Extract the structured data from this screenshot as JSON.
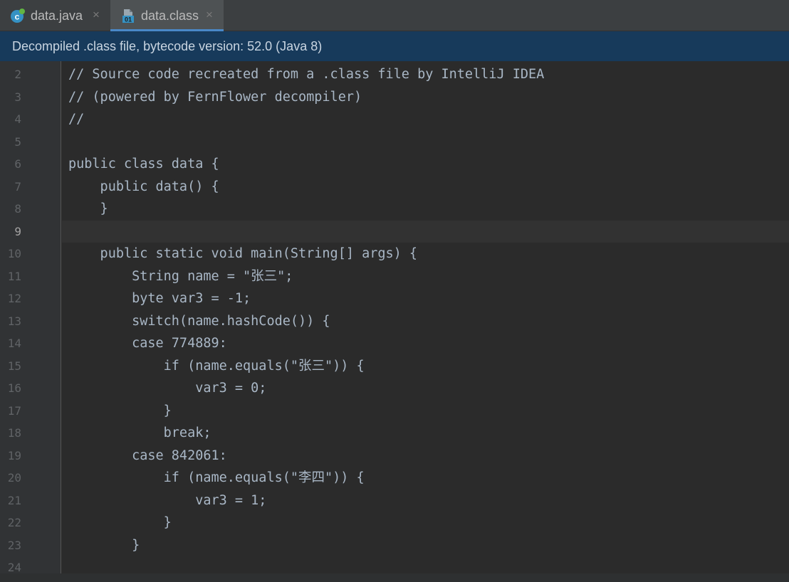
{
  "tabs": [
    {
      "label": "data.java",
      "icon": "java-class-icon",
      "active": false
    },
    {
      "label": "data.class",
      "icon": "class-file-icon",
      "active": true
    }
  ],
  "close_glyph": "×",
  "banner": {
    "text": "Decompiled .class file, bytecode version: 52.0 (Java 8)"
  },
  "editor": {
    "current_line": 9,
    "lines": [
      {
        "num": "2",
        "text": "// Source code recreated from a .class file by IntelliJ IDEA"
      },
      {
        "num": "3",
        "text": "// (powered by FernFlower decompiler)"
      },
      {
        "num": "4",
        "text": "//"
      },
      {
        "num": "5",
        "text": ""
      },
      {
        "num": "6",
        "text": "public class data {"
      },
      {
        "num": "7",
        "text": "    public data() {"
      },
      {
        "num": "8",
        "text": "    }"
      },
      {
        "num": "9",
        "text": ""
      },
      {
        "num": "10",
        "text": "    public static void main(String[] args) {"
      },
      {
        "num": "11",
        "text": "        String name = \"张三\";"
      },
      {
        "num": "12",
        "text": "        byte var3 = -1;"
      },
      {
        "num": "13",
        "text": "        switch(name.hashCode()) {"
      },
      {
        "num": "14",
        "text": "        case 774889:"
      },
      {
        "num": "15",
        "text": "            if (name.equals(\"张三\")) {"
      },
      {
        "num": "16",
        "text": "                var3 = 0;"
      },
      {
        "num": "17",
        "text": "            }"
      },
      {
        "num": "18",
        "text": "            break;"
      },
      {
        "num": "19",
        "text": "        case 842061:"
      },
      {
        "num": "20",
        "text": "            if (name.equals(\"李四\")) {"
      },
      {
        "num": "21",
        "text": "                var3 = 1;"
      },
      {
        "num": "22",
        "text": "            }"
      },
      {
        "num": "23",
        "text": "        }"
      },
      {
        "num": "24",
        "text": ""
      }
    ]
  },
  "colors": {
    "editor_bg": "#2b2b2b",
    "gutter_bg": "#313335",
    "banner_bg": "#173a5b",
    "text": "#a9b7c6",
    "tab_accent": "#4a88c7"
  }
}
